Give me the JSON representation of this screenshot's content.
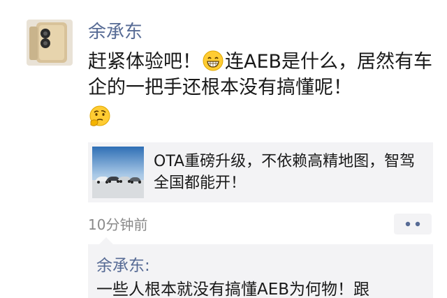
{
  "post": {
    "author": "余承东",
    "text_part1": "赶紧体验吧！",
    "emoji1": "grinning-face-icon",
    "text_part2": "连AEB是什么，居然有车企的一把手还根本没有搞懂呢！",
    "emoji2": "thinking-face-icon",
    "link_card": {
      "title": "OTA重磅升级，不依赖高精地图，智驾全国都能开！",
      "thumbnail": "cars-lineup-image"
    },
    "timestamp": "10分钟前",
    "more_icon": "more-dots-icon"
  },
  "comment": {
    "author": "余承东:",
    "text": "一些人根本就没有搞懂AEB为何物！跟"
  },
  "colors": {
    "name_link": "#576b95",
    "text": "#191919",
    "muted": "#8a8a8a",
    "card_bg": "#f3f3f5"
  }
}
